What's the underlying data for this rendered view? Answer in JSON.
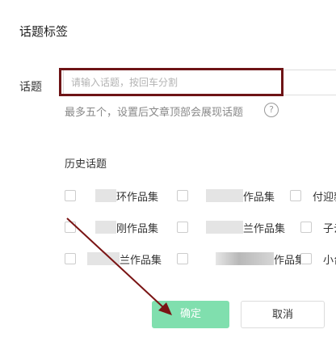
{
  "dialog": {
    "title": "话题标签"
  },
  "topic": {
    "label": "话题",
    "placeholder": "请输入话题，按回车分割",
    "hint": "最多五个，设置后文章顶部会展现话题",
    "help_glyph": "?"
  },
  "history": {
    "title": "历史话题",
    "items": [
      {
        "label": "环作品集"
      },
      {
        "label": "作品集"
      },
      {
        "label": "付迎新"
      },
      {
        "label": "刚作品集"
      },
      {
        "label": "兰作品集"
      },
      {
        "label": "子云"
      },
      {
        "label": "兰作品集"
      },
      {
        "label": "作品集"
      },
      {
        "label": "小台"
      }
    ]
  },
  "buttons": {
    "confirm": "确定",
    "cancel": "取消"
  },
  "colors": {
    "confirm_bg": "#80dfae",
    "annotation": "#6e1416"
  }
}
